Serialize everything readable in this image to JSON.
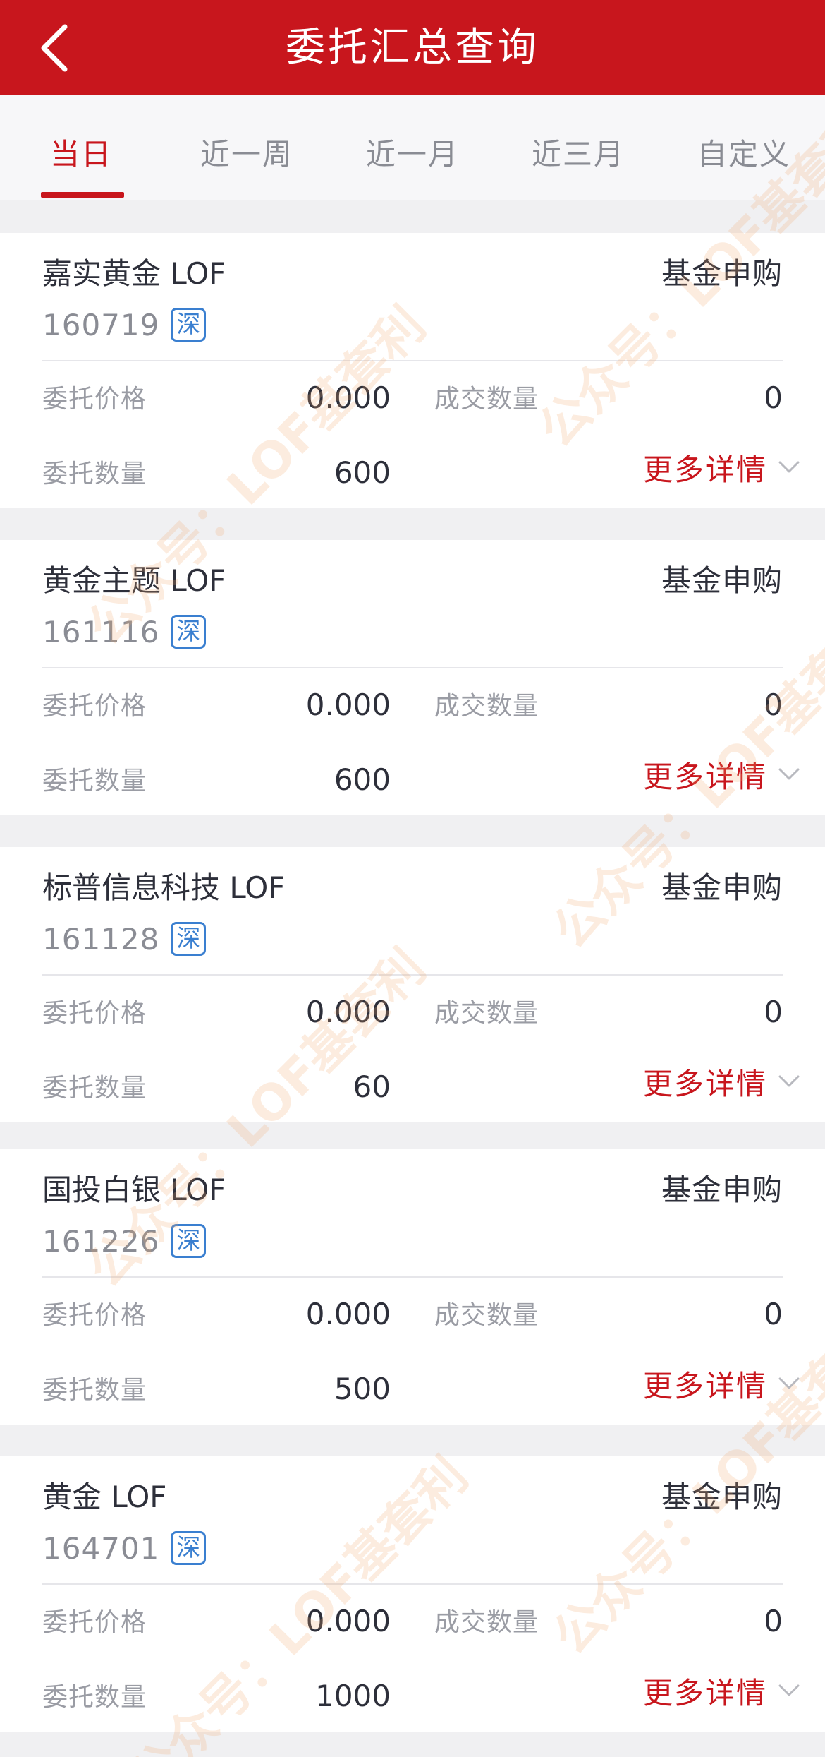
{
  "header": {
    "title": "委托汇总查询",
    "back_icon": "chevron-left-icon"
  },
  "tabs": [
    {
      "label": "当日",
      "active": true
    },
    {
      "label": "近一周",
      "active": false
    },
    {
      "label": "近一月",
      "active": false
    },
    {
      "label": "近三月",
      "active": false
    },
    {
      "label": "自定义",
      "active": false
    }
  ],
  "labels": {
    "price": "委托价格",
    "filled": "成交数量",
    "qty": "委托数量",
    "more": "更多详情"
  },
  "orders": [
    {
      "name": "嘉实黄金 LOF",
      "code": "160719",
      "market": "深",
      "type": "基金申购",
      "price": "0.000",
      "filled": "0",
      "qty": "600"
    },
    {
      "name": "黄金主题 LOF",
      "code": "161116",
      "market": "深",
      "type": "基金申购",
      "price": "0.000",
      "filled": "0",
      "qty": "600"
    },
    {
      "name": "标普信息科技 LOF",
      "code": "161128",
      "market": "深",
      "type": "基金申购",
      "price": "0.000",
      "filled": "0",
      "qty": "60"
    },
    {
      "name": "国投白银 LOF",
      "code": "161226",
      "market": "深",
      "type": "基金申购",
      "price": "0.000",
      "filled": "0",
      "qty": "500"
    },
    {
      "name": "黄金 LOF",
      "code": "164701",
      "market": "深",
      "type": "基金申购",
      "price": "0.000",
      "filled": "0",
      "qty": "1000"
    }
  ],
  "watermark": "公众号：LOF基套利",
  "colors": {
    "accent": "#c8161d",
    "badge": "#3a7fd0"
  }
}
